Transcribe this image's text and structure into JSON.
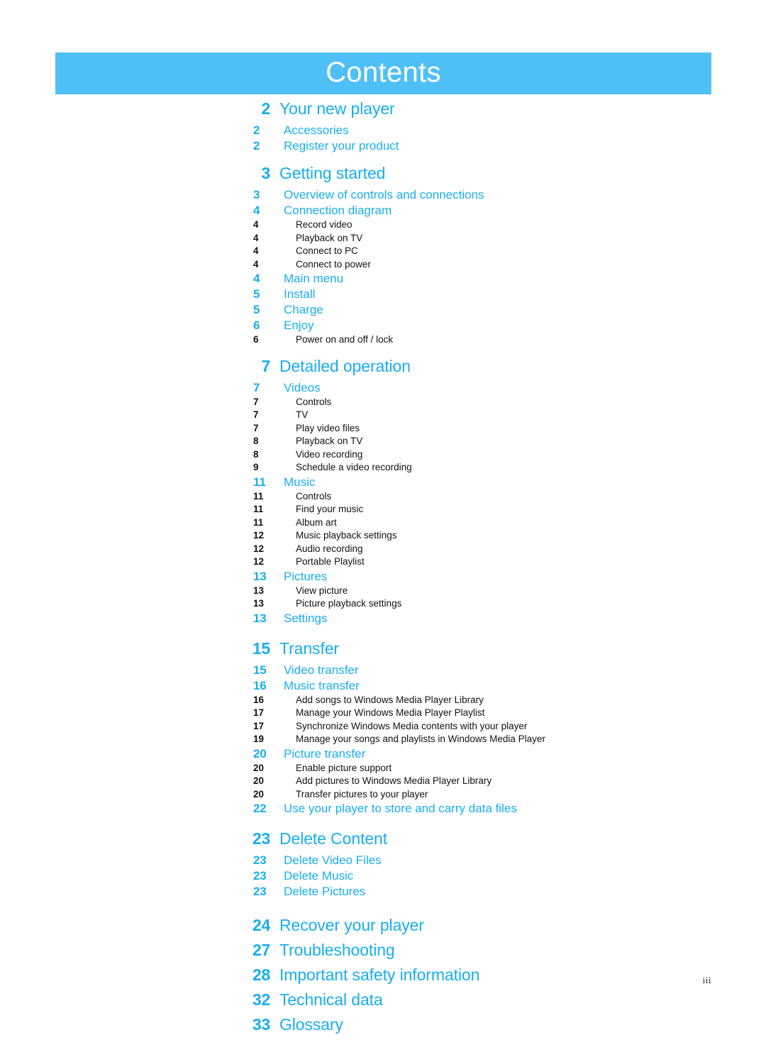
{
  "header": {
    "title": "Contents",
    "banner_color": "#4fc0f5"
  },
  "colors": {
    "banner": "#4fc0f5",
    "heading_blue": "#18aef0",
    "body_text": "#111111"
  },
  "footer": {
    "page_number": "iii"
  },
  "toc": {
    "entries": [
      {
        "page": "2",
        "label": "Your new player",
        "level": 1
      },
      {
        "page": "2",
        "label": "Accessories",
        "level": 2
      },
      {
        "page": "2",
        "label": "Register your product",
        "level": 2
      },
      {
        "page": "3",
        "label": "Getting started",
        "level": 1
      },
      {
        "page": "3",
        "label": "Overview of controls and connections",
        "level": 2
      },
      {
        "page": "4",
        "label": "Connection diagram",
        "level": 2
      },
      {
        "page": "4",
        "label": "Record video",
        "level": 3
      },
      {
        "page": "4",
        "label": "Playback on TV",
        "level": 3
      },
      {
        "page": "4",
        "label": "Connect to PC",
        "level": 3
      },
      {
        "page": "4",
        "label": "Connect to power",
        "level": 3
      },
      {
        "page": "4",
        "label": "Main menu",
        "level": 2
      },
      {
        "page": "5",
        "label": "Install",
        "level": 2
      },
      {
        "page": "5",
        "label": "Charge",
        "level": 2
      },
      {
        "page": "6",
        "label": "Enjoy",
        "level": 2
      },
      {
        "page": "6",
        "label": "Power on and off / lock",
        "level": 3
      },
      {
        "page": "7",
        "label": "Detailed operation",
        "level": 1
      },
      {
        "page": "7",
        "label": "Videos",
        "level": 2
      },
      {
        "page": "7",
        "label": "Controls",
        "level": 3
      },
      {
        "page": "7",
        "label": "TV",
        "level": 3
      },
      {
        "page": "7",
        "label": "Play video files",
        "level": 3
      },
      {
        "page": "8",
        "label": "Playback on TV",
        "level": 3
      },
      {
        "page": "8",
        "label": "Video recording",
        "level": 3
      },
      {
        "page": "9",
        "label": "Schedule a video recording",
        "level": 3
      },
      {
        "page": "11",
        "label": "Music",
        "level": 2
      },
      {
        "page": "11",
        "label": "Controls",
        "level": 3
      },
      {
        "page": "11",
        "label": "Find your music",
        "level": 3
      },
      {
        "page": "11",
        "label": "Album art",
        "level": 3
      },
      {
        "page": "12",
        "label": "Music playback settings",
        "level": 3
      },
      {
        "page": "12",
        "label": "Audio recording",
        "level": 3
      },
      {
        "page": "12",
        "label": "Portable Playlist",
        "level": 3
      },
      {
        "page": "13",
        "label": "Pictures",
        "level": 2
      },
      {
        "page": "13",
        "label": "View picture",
        "level": 3
      },
      {
        "page": "13",
        "label": "Picture playback settings",
        "level": 3
      },
      {
        "page": "13",
        "label": "Settings",
        "level": 2
      },
      {
        "page": "15",
        "label": "Transfer",
        "level": 1
      },
      {
        "page": "15",
        "label": "Video transfer",
        "level": 2
      },
      {
        "page": "16",
        "label": "Music transfer",
        "level": 2
      },
      {
        "page": "16",
        "label": "Add songs to Windows Media Player Library",
        "level": 3
      },
      {
        "page": "17",
        "label": "Manage your Windows Media Player Playlist",
        "level": 3
      },
      {
        "page": "17",
        "label": "Synchronize Windows Media contents with your player",
        "level": 3
      },
      {
        "page": "19",
        "label": "Manage your songs and playlists in Windows Media Player",
        "level": 3
      },
      {
        "page": "20",
        "label": "Picture transfer",
        "level": 2
      },
      {
        "page": "20",
        "label": "Enable picture support",
        "level": 3
      },
      {
        "page": "20",
        "label": "Add pictures to Windows Media Player Library",
        "level": 3
      },
      {
        "page": "20",
        "label": "Transfer pictures to your player",
        "level": 3
      },
      {
        "page": "22",
        "label": "Use your player to store and carry data files",
        "level": 2
      },
      {
        "page": "23",
        "label": "Delete Content",
        "level": 1
      },
      {
        "page": "23",
        "label": "Delete Video Files",
        "level": 2
      },
      {
        "page": "23",
        "label": "Delete Music",
        "level": 2
      },
      {
        "page": "23",
        "label": "Delete Pictures",
        "level": 2
      },
      {
        "page": "24",
        "label": "Recover your player",
        "level": 1
      },
      {
        "page": "27",
        "label": "Troubleshooting",
        "level": 1
      },
      {
        "page": "28",
        "label": "Important safety information",
        "level": 1
      },
      {
        "page": "32",
        "label": "Technical data",
        "level": 1
      },
      {
        "page": "33",
        "label": "Glossary",
        "level": 1
      }
    ]
  }
}
